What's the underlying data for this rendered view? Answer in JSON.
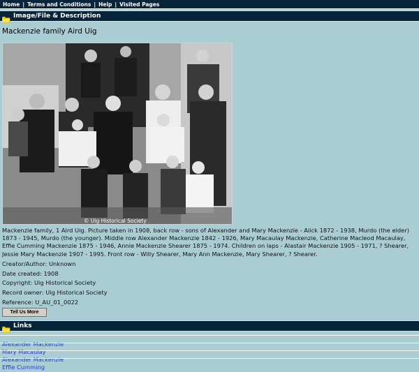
{
  "nav": {
    "items": [
      "Home",
      "Terms and Conditions",
      "Help",
      "Visited Pages"
    ]
  },
  "section_image": {
    "title": "Image/File & Description"
  },
  "record": {
    "title": "Mackenzie family Aird Uig",
    "photo_watermark": "© Uig Historical Society",
    "description": "Mackenzie family, 1 Aird Uig. Picture taken in 1908, back row - sons of Alexander and Mary Mackenzie - Alick 1872 - 1938, Murdo (the elder) 1873 - 1945, Murdo (the younger). Middle row Alexander Mackenzie 1842 - 1926, Mary Macaulay Mackenzie, Catherine Macleod Macaulay, Effie Cumming Mackenzie 1875 - 1946, Annie Mackenzie Shearer 1875 - 1974. Children on laps - Alastair Mackenzie 1905 - 1971, ? Shearer, Jessie Mary Mackenzie 1907 - 1995. Front row - Willy Shearer, Mary Ann Mackenzie, Mary Shearer, ? Shearer.",
    "creator": "Creator/Author:  Unknown",
    "date_created": "Date created:  1908",
    "copyright": "Copyright:  Uig Historical Society",
    "record_owner": "Record owner:  Uig Historical Society",
    "reference": "Reference:  U_AU_01_0022",
    "tell_button": "Tell Us More"
  },
  "section_links": {
    "title": "Links"
  },
  "links": [
    "Alexander Mackenzie",
    "Mary Macaulay",
    "Alexander Mackenzie",
    "Effie Cumming"
  ],
  "colors": {
    "background": "#a9cdd3",
    "header": "#06253b",
    "link": "#1f3fd1",
    "folder": "#f6d200"
  }
}
